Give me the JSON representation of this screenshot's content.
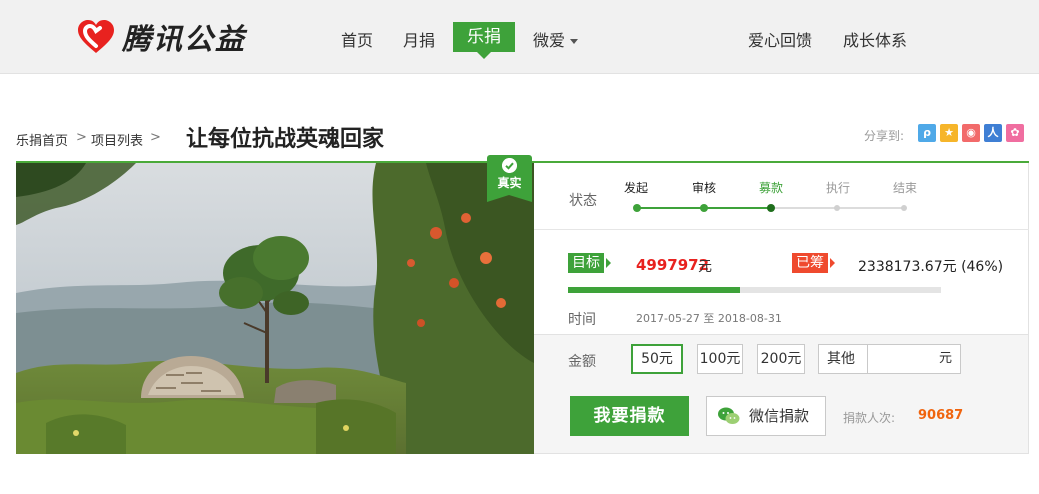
{
  "header": {
    "brand": "腾讯公益",
    "nav": [
      {
        "label": "首页"
      },
      {
        "label": "月捐"
      },
      {
        "label": "乐捐"
      },
      {
        "label": "微爱"
      },
      {
        "label": "爱心回馈"
      },
      {
        "label": "成长体系"
      }
    ],
    "active_nav": "乐捐"
  },
  "breadcrumb": {
    "items": [
      "乐捐首页",
      "项目列表"
    ],
    "separator": ">"
  },
  "project": {
    "title": "让每位抗战英魂回家",
    "verified_badge": "真实"
  },
  "share": {
    "label": "分享到:",
    "icons": [
      "qzone-icon",
      "qq-star-icon",
      "weibo-icon",
      "renren-icon",
      "tencent-weibo-icon"
    ]
  },
  "status": {
    "label": "状态",
    "steps": [
      {
        "label": "发起",
        "state": "done"
      },
      {
        "label": "审核",
        "state": "done"
      },
      {
        "label": "募款",
        "state": "current"
      },
      {
        "label": "执行",
        "state": "todo"
      },
      {
        "label": "结束",
        "state": "todo"
      }
    ]
  },
  "funding": {
    "goal_tag": "目标",
    "goal_amount": "4997972",
    "goal_unit": "元",
    "raised_tag": "已筹",
    "raised_text": "2338173.67元 (46%)",
    "progress": 0.46
  },
  "time": {
    "label": "时间",
    "value": "2017-05-27 至 2018-08-31"
  },
  "amount": {
    "label": "金额",
    "options": [
      "50元",
      "100元",
      "200元"
    ],
    "selected": "50元",
    "other_label": "其他",
    "other_unit": "元"
  },
  "actions": {
    "donate": "我要捐款",
    "wechat_donate": "微信捐款",
    "donors_label": "捐款人次:",
    "donors_count": "90687"
  },
  "colors": {
    "brand_red": "#e8221f",
    "accent_green": "#3ea23a",
    "raised_red": "#ef4a2e",
    "donor_orange": "#f0640e"
  }
}
